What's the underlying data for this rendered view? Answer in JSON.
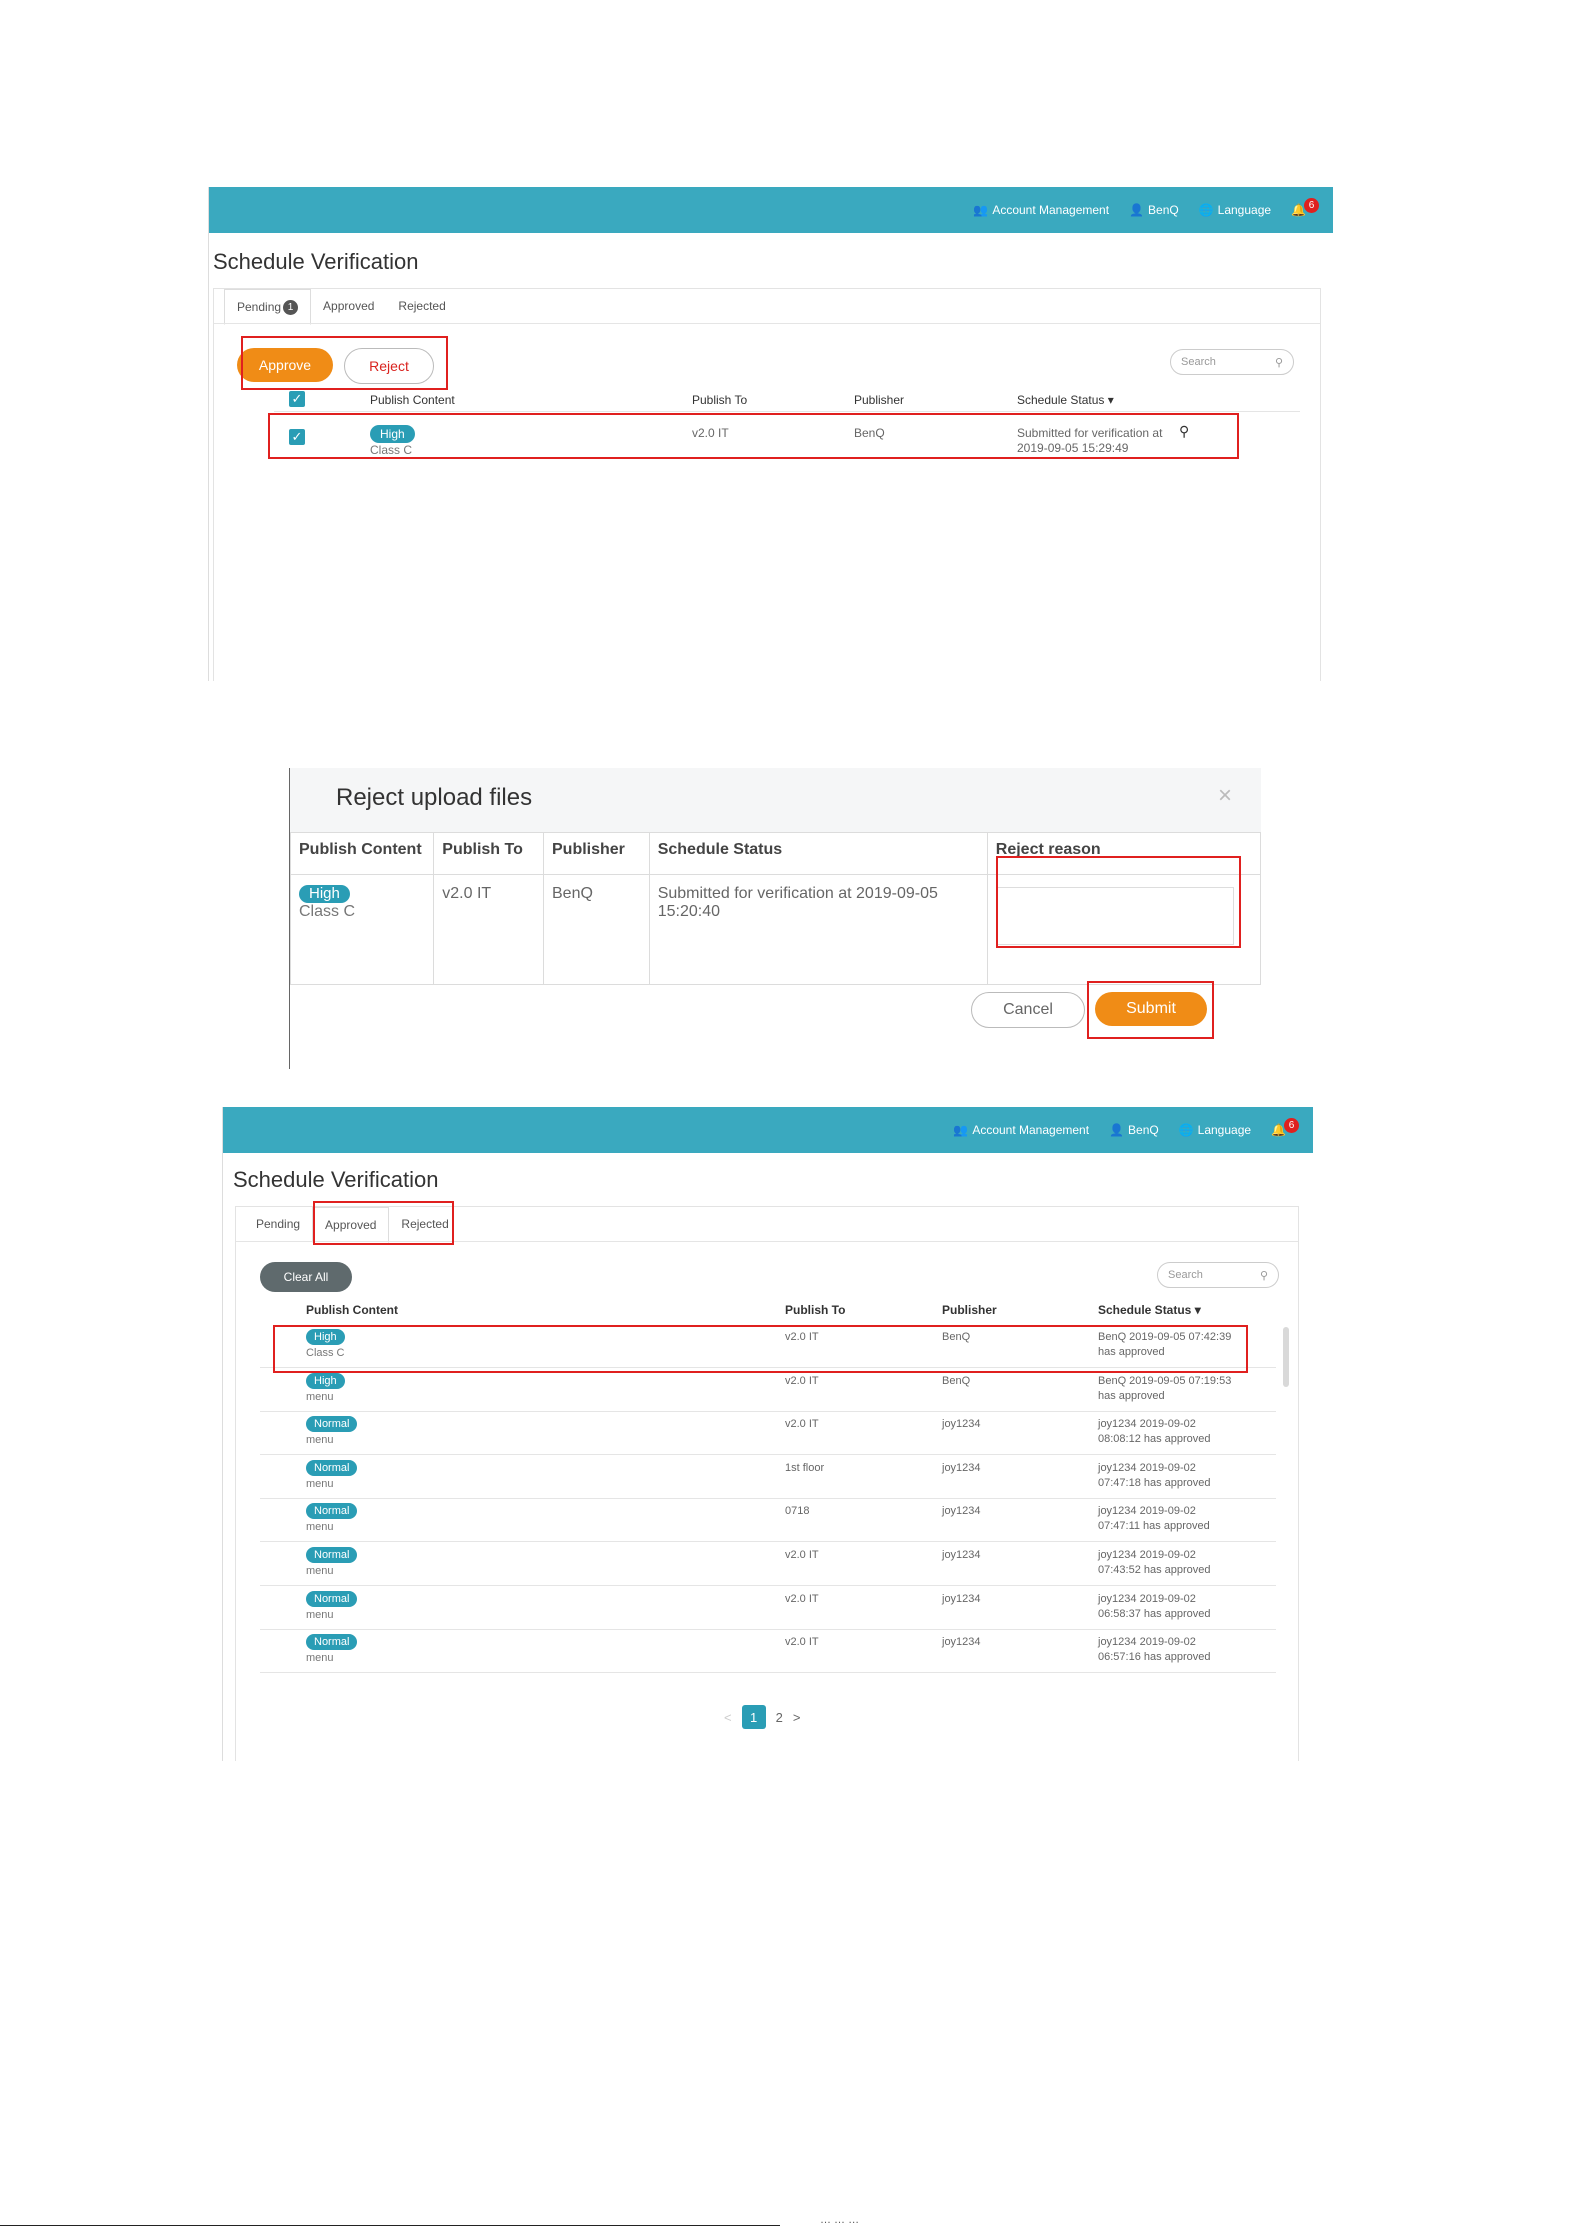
{
  "topbar": {
    "account_management": "Account Management",
    "user": "BenQ",
    "language": "Language",
    "notifications_count": "6"
  },
  "shot1": {
    "title": "Schedule Verification",
    "tabs": [
      {
        "label": "Pending",
        "count": "1"
      },
      {
        "label": "Approved"
      },
      {
        "label": "Rejected"
      }
    ],
    "approve_label": "Approve",
    "reject_label": "Reject",
    "search_placeholder": "Search",
    "headers": [
      "Publish Content",
      "Publish To",
      "Publisher",
      "Schedule Status"
    ],
    "row": {
      "priority": "High",
      "content": "Class C",
      "publish_to": "v2.0 IT",
      "publisher": "BenQ",
      "status_line1": "Submitted for verification at",
      "status_line2": "2019-09-05 15:29:49"
    }
  },
  "dialog": {
    "title": "Reject upload files",
    "close": "×",
    "headers": [
      "Publish Content",
      "Publish To",
      "Publisher",
      "Schedule Status",
      "Reject reason"
    ],
    "row": {
      "priority": "High",
      "content": "Class C",
      "publish_to": "v2.0 IT",
      "publisher": "BenQ",
      "status": "Submitted for verification at 2019-09-05 15:20:40"
    },
    "cancel_label": "Cancel",
    "submit_label": "Submit"
  },
  "shot3": {
    "title": "Schedule Verification",
    "tabs": [
      "Pending",
      "Approved",
      "Rejected"
    ],
    "clear_all_label": "Clear All",
    "search_placeholder": "Search",
    "headers": [
      "Publish Content",
      "Publish To",
      "Publisher",
      "Schedule Status"
    ],
    "rows": [
      {
        "priority": "High",
        "content": "Class C",
        "publish_to": "v2.0 IT",
        "publisher": "BenQ",
        "status1": "BenQ 2019-09-05 07:42:39",
        "status2": "has approved"
      },
      {
        "priority": "High",
        "content": "menu",
        "publish_to": "v2.0 IT",
        "publisher": "BenQ",
        "status1": "BenQ 2019-09-05 07:19:53",
        "status2": "has approved"
      },
      {
        "priority": "Normal",
        "content": "menu",
        "publish_to": "v2.0 IT",
        "publisher": "joy1234",
        "status1": "joy1234 2019-09-02",
        "status2": "08:08:12 has approved"
      },
      {
        "priority": "Normal",
        "content": "menu",
        "publish_to": "1st floor",
        "publisher": "joy1234",
        "status1": "joy1234 2019-09-02",
        "status2": "07:47:18 has approved"
      },
      {
        "priority": "Normal",
        "content": "menu",
        "publish_to": "0718",
        "publisher": "joy1234",
        "status1": "joy1234 2019-09-02",
        "status2": "07:47:11 has approved"
      },
      {
        "priority": "Normal",
        "content": "menu",
        "publish_to": "v2.0 IT",
        "publisher": "joy1234",
        "status1": "joy1234 2019-09-02",
        "status2": "07:43:52 has approved"
      },
      {
        "priority": "Normal",
        "content": "menu",
        "publish_to": "v2.0 IT",
        "publisher": "joy1234",
        "status1": "joy1234 2019-09-02",
        "status2": "06:58:37 has approved"
      },
      {
        "priority": "Normal",
        "content": "menu",
        "publish_to": "v2.0 IT",
        "publisher": "joy1234",
        "status1": "joy1234 2019-09-02",
        "status2": "06:57:16 has approved"
      }
    ],
    "pagination": {
      "prev": "<",
      "pages": [
        "1",
        "2"
      ],
      "next": ">"
    }
  },
  "footer": {
    "text": "… … …"
  }
}
